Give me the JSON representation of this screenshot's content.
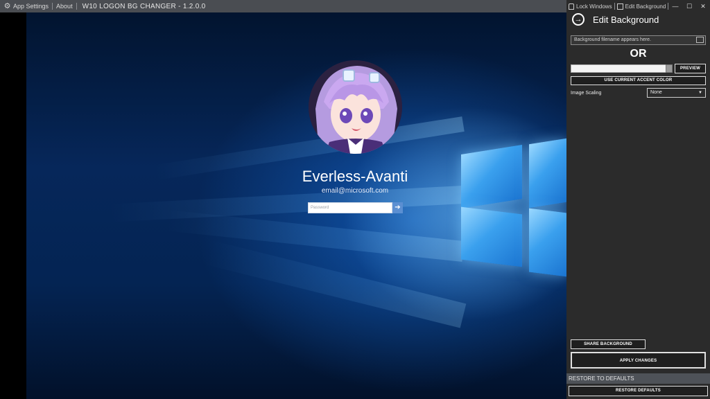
{
  "titlebar": {
    "app_settings": "App Settings",
    "about": "About",
    "title": "W10 LOGON BG CHANGER - 1.2.0.0"
  },
  "panel_top": {
    "lock_windows": "Lock Windows",
    "edit_background": "Edit Background"
  },
  "login_preview": {
    "username": "Everless-Avanti",
    "email": "email@microsoft.com",
    "password_placeholder": "Password"
  },
  "panel": {
    "title": "Edit Background",
    "filename_placeholder": "Background filename appears here.",
    "or_label": "OR",
    "preview_button": "PREVIEW",
    "accent_button": "USE CURRENT ACCENT COLOR",
    "scaling_label": "Image Scaling",
    "scaling_value": "None",
    "share_button": "SHARE BACKGROUND",
    "apply_button": "APPLY CHANGES",
    "restore_header": "RESTORE TO DEFAULTS",
    "restore_button": "RESTORE DEFAULTS"
  },
  "colors": {
    "panel_bg": "#2b2b2b",
    "titlebar_bg": "#4a4d52",
    "accent_blue": "#1b74d0"
  }
}
